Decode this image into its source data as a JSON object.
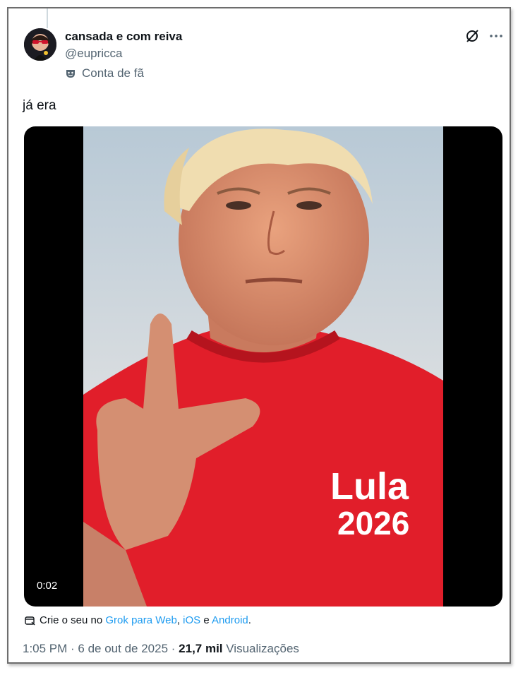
{
  "author": {
    "name": "cansada e com reiva",
    "handle": "@eupricca",
    "badge": "Conta de fã"
  },
  "tweet": {
    "text": "já era"
  },
  "media": {
    "duration": "0:02",
    "shirt_text_line1": "Lula",
    "shirt_text_line2": "2026"
  },
  "grok": {
    "prefix": "Crie o seu no",
    "link1": "Grok para Web",
    "sep1": ",",
    "link2": "iOS",
    "sep2": "e",
    "link3": "Android",
    "end": "."
  },
  "meta": {
    "time_date": "1:05 PM · 6 de out de 2025 ·",
    "views_count": "21,7 mil",
    "views_label": "Visualizações"
  },
  "colors": {
    "link": "#1d9bf0",
    "secondary_text": "#536471",
    "primary_text": "#0f1419",
    "shirt_red": "#e11e2a"
  }
}
